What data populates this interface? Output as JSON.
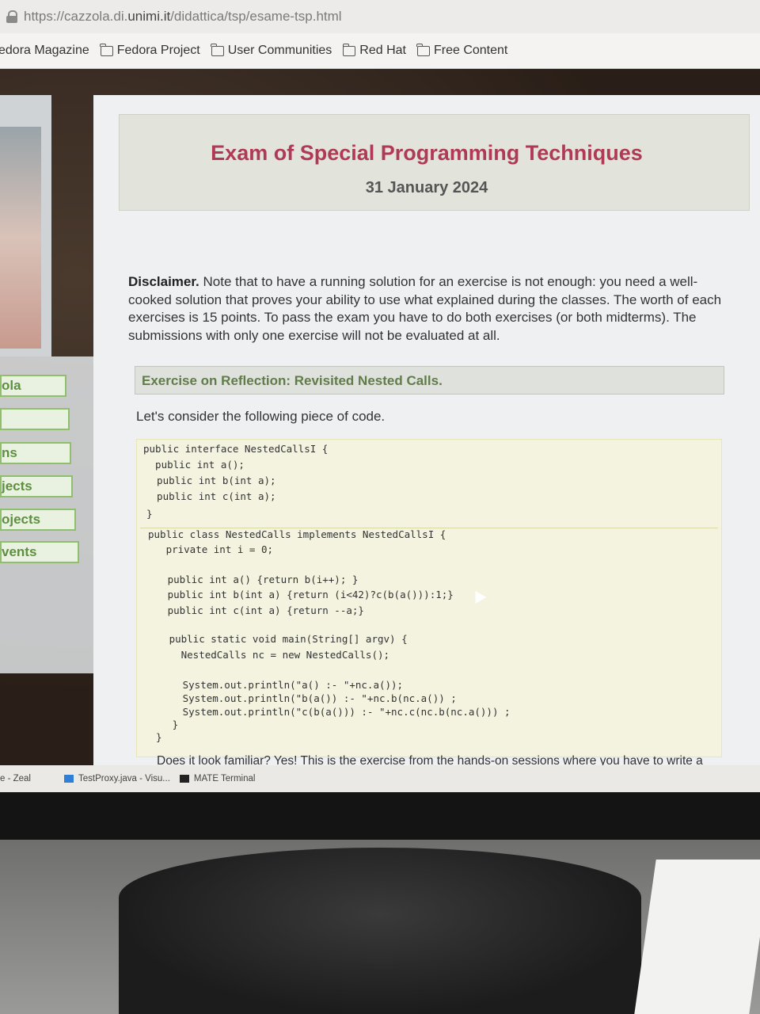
{
  "browser": {
    "url_prefix": "https://cazzola.di.",
    "url_host": "unimi.it",
    "url_path": "/didattica/tsp/esame-tsp.html",
    "bookmarks": [
      "edora Magazine",
      "Fedora Project",
      "User Communities",
      "Red Hat",
      "Free Content"
    ]
  },
  "sidebar": {
    "items": [
      "ola",
      "",
      "ns",
      "jects",
      "ojects",
      "vents"
    ]
  },
  "page": {
    "title": "Exam of Special Programming Techniques",
    "date": "31 January 2024",
    "disclaimer_label": "Disclaimer.",
    "disclaimer_text": "Note that to have a running solution for an exercise is not enough: you need a well-cooked solution that proves your ability to use what explained during the classes. The worth of each exercises is 15 points. To pass the exam you have to do both exercises (or both midterms). The submissions with only one exercise will not be evaluated at all.",
    "exercise_title": "Exercise on Reflection: Revisited Nested Calls.",
    "lead": "Let's consider the following piece of code.",
    "code_lines": [
      "public interface NestedCallsI {",
      "  public int a();",
      "  public int b(int a);",
      "  public int c(int a);",
      "}",
      "public class NestedCalls implements NestedCallsI {",
      "   private int i = 0;",
      "",
      "   public int a() {return b(i++); }",
      "   public int b(int a) {return (i<42)?c(b(a())):1;}",
      "   public int c(int a) {return --a;}",
      "",
      "   public static void main(String[] argv) {",
      "     NestedCalls nc = new NestedCalls();",
      "",
      "     System.out.println(\"a() :- \"+nc.a());",
      "     System.out.println(\"b(a()) :- \"+nc.b(nc.a()) ;",
      "     System.out.println(\"c(b(a())) :- \"+nc.c(nc.b(nc.a())) ;",
      "   }",
      "}"
    ],
    "bottom_text": "Does it look familiar? Yes! This is the exercise from the hands-on sessions where you have to write a"
  },
  "taskbar": {
    "items": [
      "e - Zeal",
      "TestProxy.java - Visu...",
      "MATE Terminal"
    ]
  }
}
